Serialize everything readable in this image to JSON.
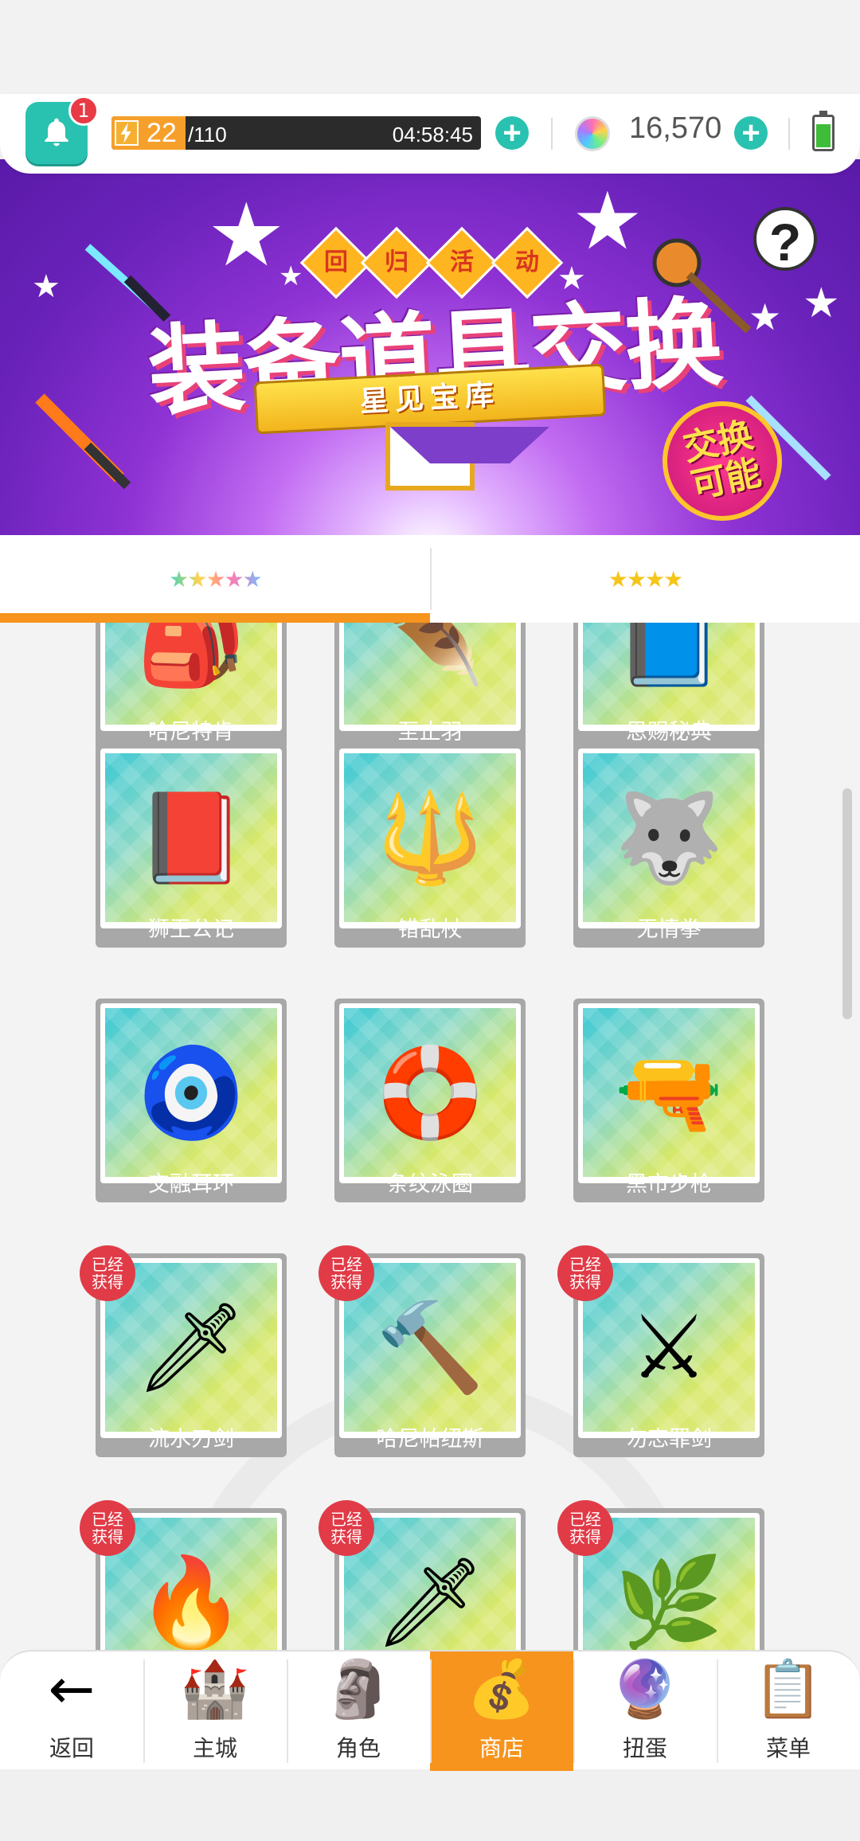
{
  "header": {
    "notification_count": "1",
    "energy_current": "22",
    "energy_max": "/110",
    "energy_level": 0.2,
    "energy_timer": "04:58:45",
    "gems": "16,570",
    "plus_symbol": "+",
    "battery_level": 0.8
  },
  "banner": {
    "tags": [
      "回",
      "归",
      "活",
      "动"
    ],
    "title": "装备道具交换",
    "ribbon": "星见宝库",
    "stamp_line1": "交换",
    "stamp_line2": "可能",
    "help": "?"
  },
  "tabs": [
    {
      "label": "★★★★★",
      "active": true
    },
    {
      "label": "★★★★",
      "active": false
    }
  ],
  "obtained_label_1": "已经",
  "obtained_label_2": "获得",
  "items": [
    {
      "name": "哈尼特肯",
      "icon": "🎒",
      "obtained": false
    },
    {
      "name": "至止羽",
      "icon": "🪶",
      "obtained": false
    },
    {
      "name": "恩赐秘典",
      "icon": "📘",
      "obtained": false
    },
    {
      "name": "狮王公记",
      "icon": "📕",
      "obtained": false
    },
    {
      "name": "错乱杖",
      "icon": "🔱",
      "obtained": false
    },
    {
      "name": "无情拳",
      "icon": "🐺",
      "obtained": false
    },
    {
      "name": "交融耳环",
      "icon": "🧿",
      "obtained": false
    },
    {
      "name": "条纹泳圈",
      "icon": "🛟",
      "obtained": false
    },
    {
      "name": "黑市步枪",
      "icon": "🔫",
      "obtained": false
    },
    {
      "name": "流水刃剑",
      "icon": "🗡",
      "obtained": true
    },
    {
      "name": "哈尼帕纽斯",
      "icon": "🔨",
      "obtained": true
    },
    {
      "name": "勿忘罪剑",
      "icon": "⚔",
      "obtained": true
    },
    {
      "name": "",
      "icon": "🔥",
      "obtained": true
    },
    {
      "name": "",
      "icon": "🗡",
      "obtained": true
    },
    {
      "name": "",
      "icon": "🌿",
      "obtained": true
    }
  ],
  "nav": [
    {
      "label": "返回",
      "icon": "←",
      "active": false
    },
    {
      "label": "主城",
      "icon": "🏰",
      "active": false
    },
    {
      "label": "角色",
      "icon": "🗿",
      "active": false
    },
    {
      "label": "商店",
      "icon": "💰",
      "active": true
    },
    {
      "label": "扭蛋",
      "icon": "🔮",
      "active": false
    },
    {
      "label": "菜单",
      "icon": "📋",
      "active": false
    }
  ]
}
